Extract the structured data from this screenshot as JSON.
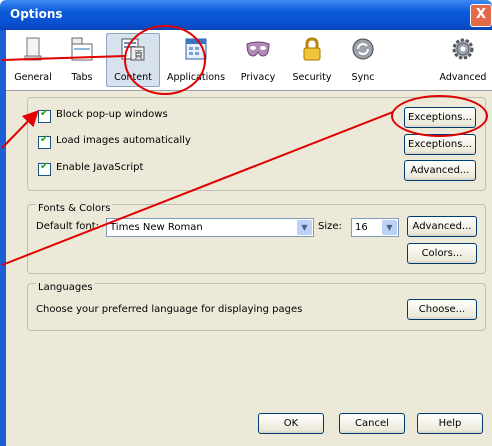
{
  "window": {
    "title": "Options",
    "close_glyph": "X"
  },
  "tabs": [
    {
      "label": "General",
      "icon": "general-icon"
    },
    {
      "label": "Tabs",
      "icon": "tabs-icon"
    },
    {
      "label": "Content",
      "icon": "content-icon",
      "selected": true
    },
    {
      "label": "Applications",
      "icon": "applications-icon"
    },
    {
      "label": "Privacy",
      "icon": "privacy-mask-icon"
    },
    {
      "label": "Security",
      "icon": "padlock-icon"
    },
    {
      "label": "Sync",
      "icon": "sync-icon"
    },
    {
      "label": "Advanced",
      "icon": "gear-icon"
    }
  ],
  "content": {
    "block_popups": {
      "label": "Block pop-up windows",
      "checked": true,
      "button": "Exceptions..."
    },
    "load_images": {
      "label": "Load images automatically",
      "checked": true,
      "button": "Exceptions..."
    },
    "javascript": {
      "label": "Enable JavaScript",
      "checked": true,
      "button": "Advanced..."
    }
  },
  "fonts": {
    "group_label": "Fonts & Colors",
    "default_font_label": "Default font:",
    "default_font_value": "Times New Roman",
    "size_label": "Size:",
    "size_value": "16",
    "advanced_button": "Advanced...",
    "colors_button": "Colors..."
  },
  "languages": {
    "group_label": "Languages",
    "description": "Choose your preferred language for displaying pages",
    "choose_button": "Choose..."
  },
  "footer": {
    "ok": "OK",
    "cancel": "Cancel",
    "help": "Help"
  },
  "colors": {
    "annotation": "#e00000",
    "titlebar": "#0a5ad8",
    "dialog": "#ece9d8"
  }
}
